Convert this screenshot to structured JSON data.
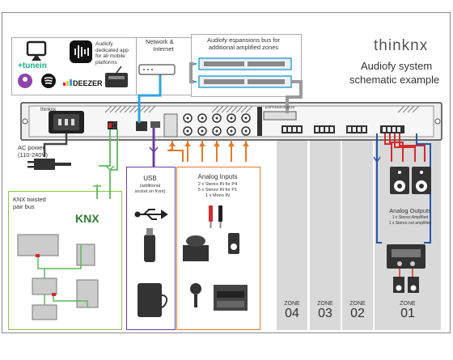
{
  "brand": {
    "logo_text": "thinknx",
    "title_line1": "Audiofy system",
    "title_line2": "schematic example"
  },
  "apps": {
    "audiofy_text": "Audiofy\ndedicated app\nfor all mobile\nplatforms",
    "tunein": "+tunein",
    "deezer": "DEEZER",
    "network_label": "Network &\nInternet"
  },
  "expansion_bus": {
    "label": "Audiofy espansions bus for\nadditional amplified zones"
  },
  "rack": {
    "brand": "thinknx",
    "expansion_label": "EXPANSION BUS"
  },
  "ac_power": {
    "label": "AC power\n(110-240V)"
  },
  "knx": {
    "label": "KNX twisted\npair bus",
    "logo": "KNX"
  },
  "usb": {
    "label": "USB",
    "sublabel": "(additional\nsocket on front)"
  },
  "analog_inputs": {
    "title": "Analog Inputs",
    "lines": [
      "2 x Stereo IN for P4",
      "5 x Stereo IN for P1",
      "1 x Mono IN"
    ]
  },
  "analog_outputs": {
    "title": "Analog Outputs",
    "lines": [
      "1 x Stereo Amplified",
      "1 x Stereo not amplified"
    ]
  },
  "zones": [
    {
      "label": "ZONE",
      "number": "04"
    },
    {
      "label": "ZONE",
      "number": "03"
    },
    {
      "label": "ZONE",
      "number": "02"
    },
    {
      "label": "ZONE",
      "number": "01"
    }
  ],
  "colors": {
    "network": "#2ba5df",
    "knx_green": "#5cb85c",
    "usb_purple": "#6b3fa0",
    "analog_orange": "#e07b2a",
    "output_blue": "#2156a8",
    "speaker_red": "#d42a2a",
    "zone_bg": "#d9d9d9"
  }
}
